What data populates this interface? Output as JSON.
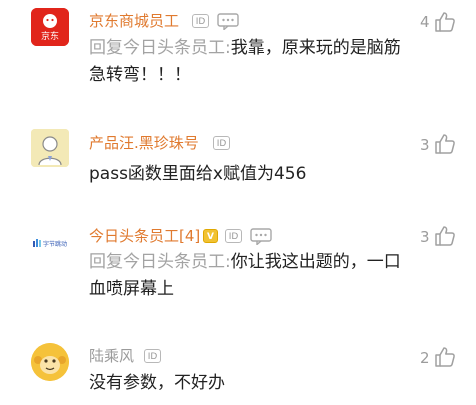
{
  "comments": [
    {
      "name": "京东商城员工",
      "reply_prefix": "回复今日头条员工:",
      "reply_text": "我靠，原来玩的是脑筋急转弯！！！",
      "likes": "4",
      "avatar_text": "京东",
      "badge": "ID"
    },
    {
      "name": "产品汪.黑珍珠号",
      "text": "pass函数里面给x赋值为456",
      "likes": "3",
      "badge": "ID"
    },
    {
      "name": "今日头条员工[4]",
      "reply_prefix": "回复今日头条员工:",
      "reply_text": "你让我这出题的，一口血喷屏幕上",
      "likes": "3",
      "avatar_text": "字节跳动",
      "badge": "ID",
      "level_badge": "V"
    },
    {
      "name": "陆乘风",
      "text": "没有参数，不好办",
      "likes": "2",
      "badge": "ID"
    }
  ],
  "colors": {
    "name_highlight": "#e07a2f",
    "name_normal": "#9b9b9b",
    "jd_red": "#e1251b"
  }
}
